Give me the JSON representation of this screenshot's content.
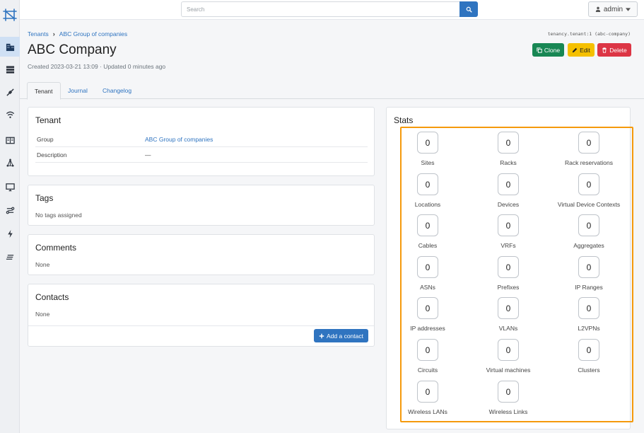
{
  "topbar": {
    "search_placeholder": "Search",
    "user_label": "admin"
  },
  "breadcrumb": [
    "Tenants",
    "ABC Group of companies"
  ],
  "object_identifier": "tenancy.tenant:1 (abc-company)",
  "page_title": "ABC Company",
  "subtitle": "Created 2023-03-21 13:09 · Updated 0 minutes ago",
  "actions": {
    "clone": "Clone",
    "edit": "Edit",
    "delete": "Delete"
  },
  "tabs": [
    "Tenant",
    "Journal",
    "Changelog"
  ],
  "tenant_card": {
    "title": "Tenant",
    "rows": [
      {
        "key": "Group",
        "value": "ABC Group of companies"
      },
      {
        "key": "Description",
        "value": "—"
      }
    ]
  },
  "tags_card": {
    "title": "Tags",
    "text": "No tags assigned"
  },
  "comments_card": {
    "title": "Comments",
    "text": "None"
  },
  "contacts_card": {
    "title": "Contacts",
    "text": "None",
    "add_label": "Add a contact"
  },
  "stats": {
    "title": "Stats",
    "items": [
      {
        "value": "0",
        "label": "Sites"
      },
      {
        "value": "0",
        "label": "Racks"
      },
      {
        "value": "0",
        "label": "Rack reservations"
      },
      {
        "value": "0",
        "label": "Locations"
      },
      {
        "value": "0",
        "label": "Devices"
      },
      {
        "value": "0",
        "label": "Virtual Device Contexts"
      },
      {
        "value": "0",
        "label": "Cables"
      },
      {
        "value": "0",
        "label": "VRFs"
      },
      {
        "value": "0",
        "label": "Aggregates"
      },
      {
        "value": "0",
        "label": "ASNs"
      },
      {
        "value": "0",
        "label": "Prefixes"
      },
      {
        "value": "0",
        "label": "IP Ranges"
      },
      {
        "value": "0",
        "label": "IP addresses"
      },
      {
        "value": "0",
        "label": "VLANs"
      },
      {
        "value": "0",
        "label": "L2VPNs"
      },
      {
        "value": "0",
        "label": "Circuits"
      },
      {
        "value": "0",
        "label": "Virtual machines"
      },
      {
        "value": "0",
        "label": "Clusters"
      },
      {
        "value": "0",
        "label": "Wireless LANs"
      },
      {
        "value": "0",
        "label": "Wireless Links"
      }
    ]
  },
  "sidebar_icons": [
    "organization-icon",
    "devices-icon",
    "connections-icon",
    "wireless-icon",
    "ipam-icon",
    "overlay-icon",
    "virtualization-icon",
    "circuits-icon",
    "power-icon",
    "other-icon"
  ],
  "colors": {
    "primary": "#2f74c0",
    "success": "#188754",
    "warning": "#f5c000",
    "danger": "#dc3545",
    "highlight": "#f59a0c"
  }
}
